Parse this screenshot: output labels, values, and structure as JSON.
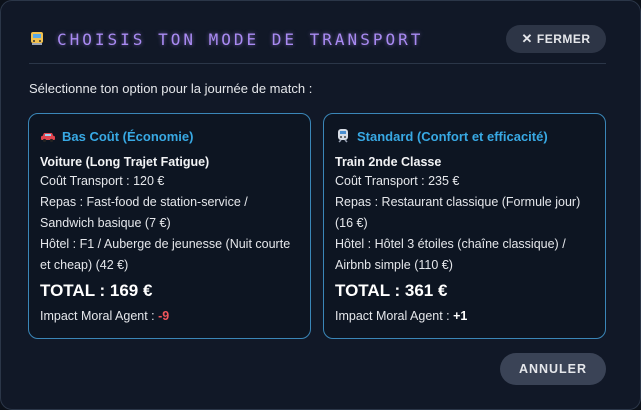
{
  "modal": {
    "title": "CHOISIS TON MODE DE TRANSPORT",
    "title_icon": "tram-icon",
    "close_label": "FERMER",
    "subtitle": "Sélectionne ton option pour la journée de match :",
    "cancel_label": "ANNULER"
  },
  "options": [
    {
      "icon": "car-icon",
      "heading": "Bas Coût (Économie)",
      "vehicle": "Voiture (Long Trajet Fatigue)",
      "transport": "Coût Transport : 120 €",
      "meal": "Repas : Fast-food de station-service / Sandwich basique (7 €)",
      "hotel": "Hôtel : F1 / Auberge de jeunesse (Nuit courte et cheap) (42 €)",
      "total": "TOTAL : 169 €",
      "moral_label": "Impact Moral Agent : ",
      "moral_value": "-9"
    },
    {
      "icon": "train-icon",
      "heading": "Standard (Confort et efficacité)",
      "vehicle": "Train 2nde Classe",
      "transport": "Coût Transport : 235 €",
      "meal": "Repas : Restaurant classique (Formule jour) (16 €)",
      "hotel": "Hôtel : Hôtel 3 étoiles (chaîne classique) / Airbnb simple (110 €)",
      "total": "TOTAL : 361 €",
      "moral_label": "Impact Moral Agent : ",
      "moral_value": "+1"
    }
  ],
  "colors": {
    "accent_title": "#a98af2",
    "card_heading": "#38a9e4",
    "card_border": "#3a86b8",
    "moral_negative": "#f0555b"
  }
}
